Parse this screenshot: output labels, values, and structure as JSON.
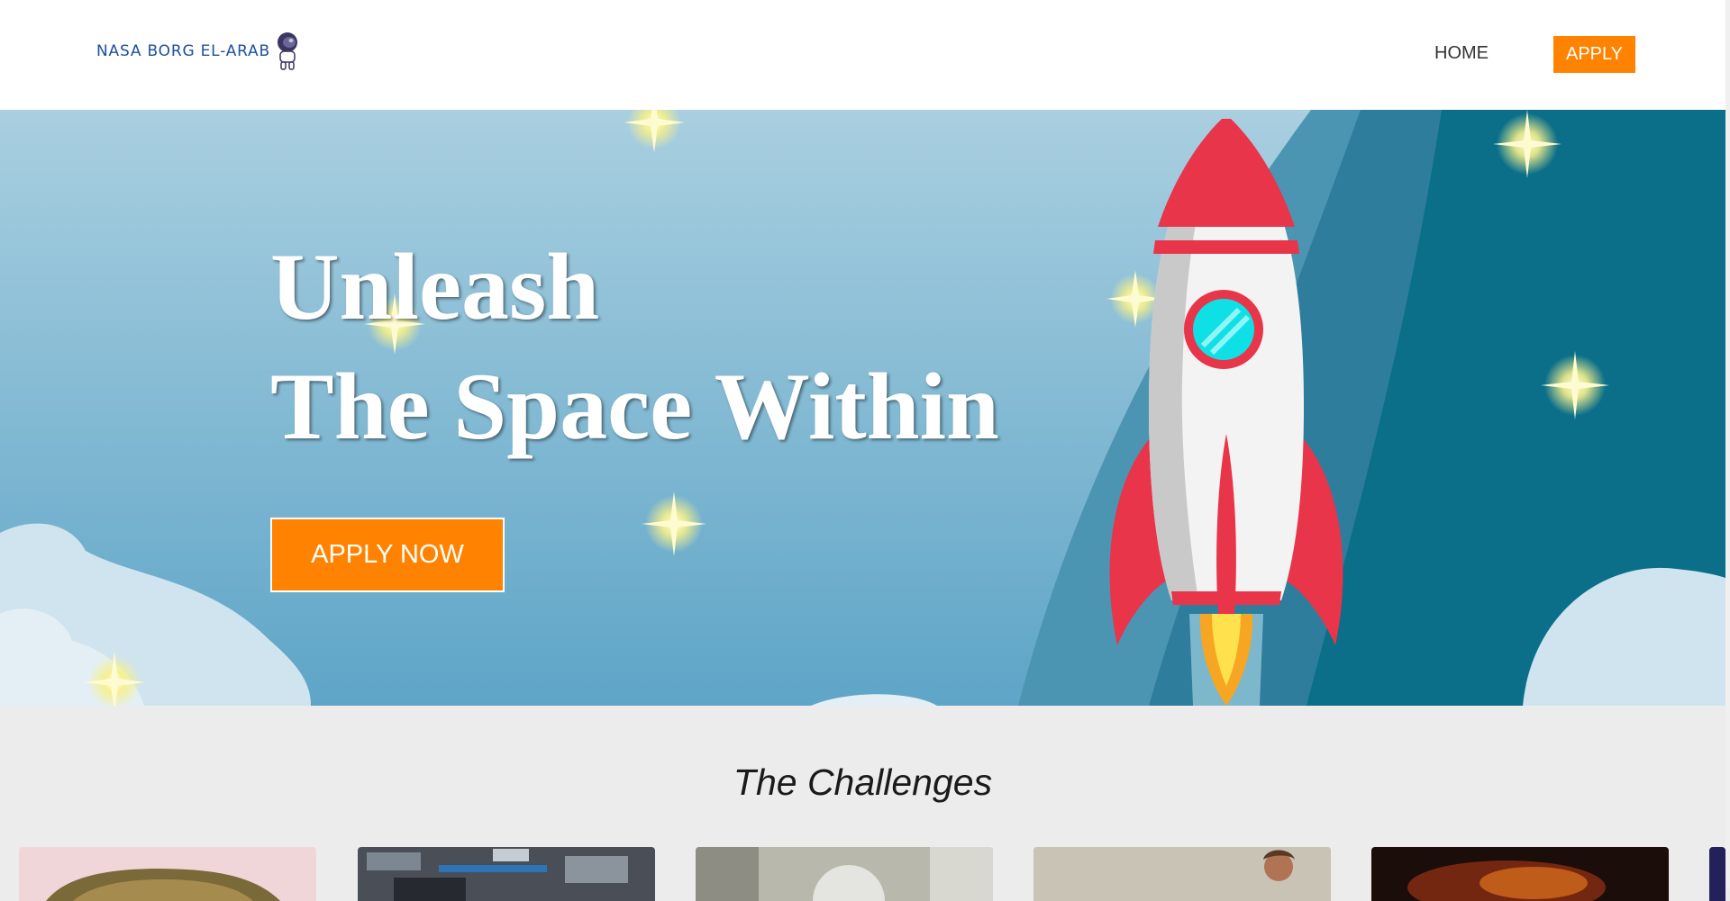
{
  "navbar": {
    "logo_text": "NASA BORG EL-ARAB",
    "home_label": "HOME",
    "apply_label": "APPLY"
  },
  "hero": {
    "title_line1": "Unleash",
    "title_line2": "The Space Within",
    "cta_label": "APPLY NOW"
  },
  "challenges": {
    "title": "The Challenges",
    "cards": [
      {
        "thumb": "rock-formation-image"
      },
      {
        "thumb": "space-station-interior-image"
      },
      {
        "thumb": "robot-assistant-image"
      },
      {
        "thumb": "astronaut-portrait-image"
      },
      {
        "thumb": "nebula-image"
      }
    ]
  },
  "colors": {
    "accent": "#ff8300",
    "hero_sky": "#6aaccb",
    "hero_deep": "#0b6f8a",
    "rocket_red": "#e8354a",
    "section_bg": "#ececec"
  }
}
